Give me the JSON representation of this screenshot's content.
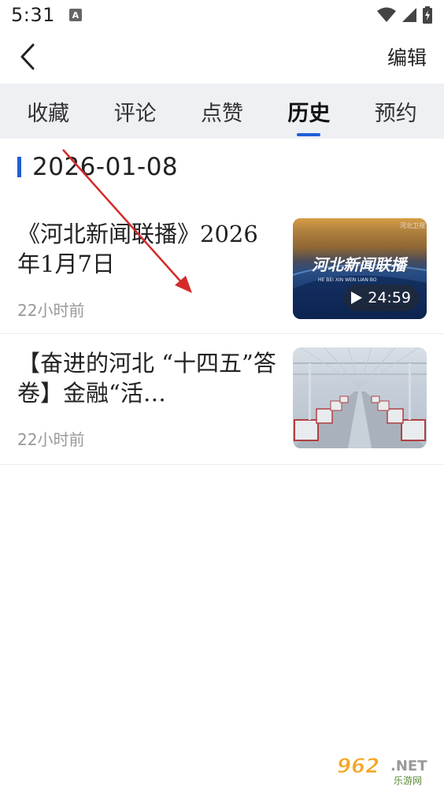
{
  "status_bar": {
    "time": "5:31",
    "a_icon": "A",
    "icons": [
      "wifi-icon",
      "signal-icon",
      "battery-icon"
    ]
  },
  "app_bar": {
    "back_icon": "chevron-left-icon",
    "edit_label": "编辑"
  },
  "tabs": [
    {
      "label": "收藏",
      "active": false
    },
    {
      "label": "评论",
      "active": false
    },
    {
      "label": "点赞",
      "active": false
    },
    {
      "label": "历史",
      "active": true
    },
    {
      "label": "预约",
      "active": false
    }
  ],
  "history": {
    "date": "2026-01-08",
    "items": [
      {
        "title": "《河北新闻联播》2026年1月7日",
        "time": "22小时前",
        "thumbnail": {
          "logo_text": "河北新闻联播",
          "logo_sub": "HE BEI XIN WEN LIAN BO",
          "duration": "24:59",
          "corner": "河北卫视"
        }
      },
      {
        "title": "【奋进的河北 “十四五”答卷】金融“活…",
        "time": "22小时前",
        "thumbnail": {
          "description_icon": "factory-image"
        }
      }
    ]
  },
  "watermark": {
    "text_main": "962",
    "text_net": ".NET",
    "text_cn": "乐游网"
  },
  "colors": {
    "accent": "#1f5fd6",
    "tab_bg": "#eef0f3",
    "arrow": "#d42a2a"
  }
}
